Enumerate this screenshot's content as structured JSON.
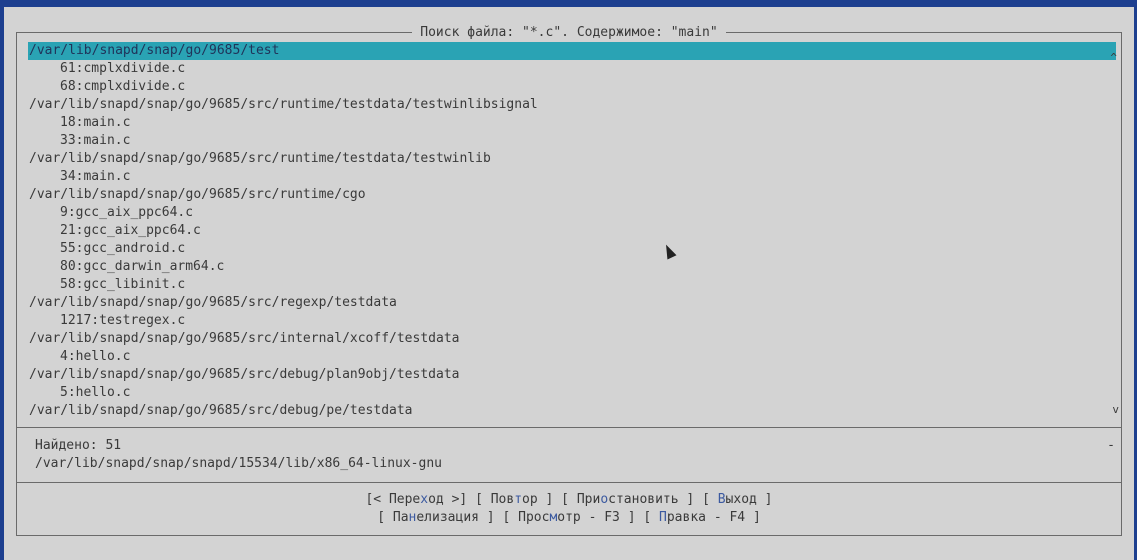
{
  "dialog": {
    "title": "Поиск файла: \"*.c\". Содержимое: \"main\""
  },
  "results": [
    {
      "text": "/var/lib/snapd/snap/go/9685/test",
      "type": "dir"
    },
    {
      "text": "61:cmplxdivide.c",
      "type": "file"
    },
    {
      "text": "68:cmplxdivide.c",
      "type": "file"
    },
    {
      "text": "/var/lib/snapd/snap/go/9685/src/runtime/testdata/testwinlibsignal",
      "type": "dir"
    },
    {
      "text": "18:main.c",
      "type": "file"
    },
    {
      "text": "33:main.c",
      "type": "file"
    },
    {
      "text": "/var/lib/snapd/snap/go/9685/src/runtime/testdata/testwinlib",
      "type": "dir"
    },
    {
      "text": "34:main.c",
      "type": "file"
    },
    {
      "text": "/var/lib/snapd/snap/go/9685/src/runtime/cgo",
      "type": "dir"
    },
    {
      "text": "9:gcc_aix_ppc64.c",
      "type": "file"
    },
    {
      "text": "21:gcc_aix_ppc64.c",
      "type": "file"
    },
    {
      "text": "55:gcc_android.c",
      "type": "file"
    },
    {
      "text": "80:gcc_darwin_arm64.c",
      "type": "file"
    },
    {
      "text": "58:gcc_libinit.c",
      "type": "file"
    },
    {
      "text": "/var/lib/snapd/snap/go/9685/src/regexp/testdata",
      "type": "dir"
    },
    {
      "text": "1217:testregex.c",
      "type": "file"
    },
    {
      "text": "/var/lib/snapd/snap/go/9685/src/internal/xcoff/testdata",
      "type": "dir"
    },
    {
      "text": "4:hello.c",
      "type": "file"
    },
    {
      "text": "/var/lib/snapd/snap/go/9685/src/debug/plan9obj/testdata",
      "type": "dir"
    },
    {
      "text": "5:hello.c",
      "type": "file"
    },
    {
      "text": "/var/lib/snapd/snap/go/9685/src/debug/pe/testdata",
      "type": "dir"
    }
  ],
  "scroll": {
    "up": "^",
    "down": "v"
  },
  "status": {
    "found": "Найдено: 51",
    "current_dir": "/var/lib/snapd/snap/snapd/15534/lib/x86_64-linux-gnu",
    "indicator": "-"
  },
  "buttons": [
    {
      "pre": "[< Пере",
      "hot": "х",
      "post": "од >]"
    },
    {
      "pre": "[ Пов",
      "hot": "т",
      "post": "ор ]"
    },
    {
      "pre": "[ При",
      "hot": "о",
      "post": "становить ]"
    },
    {
      "pre": "[ ",
      "hot": "В",
      "post": "ыход ]"
    },
    {
      "pre": "[ Па",
      "hot": "н",
      "post": "елизация ]"
    },
    {
      "pre": "[ Прос",
      "hot": "м",
      "post": "отр - F3 ]"
    },
    {
      "pre": "[ ",
      "hot": "П",
      "post": "равка - F4 ]"
    }
  ]
}
